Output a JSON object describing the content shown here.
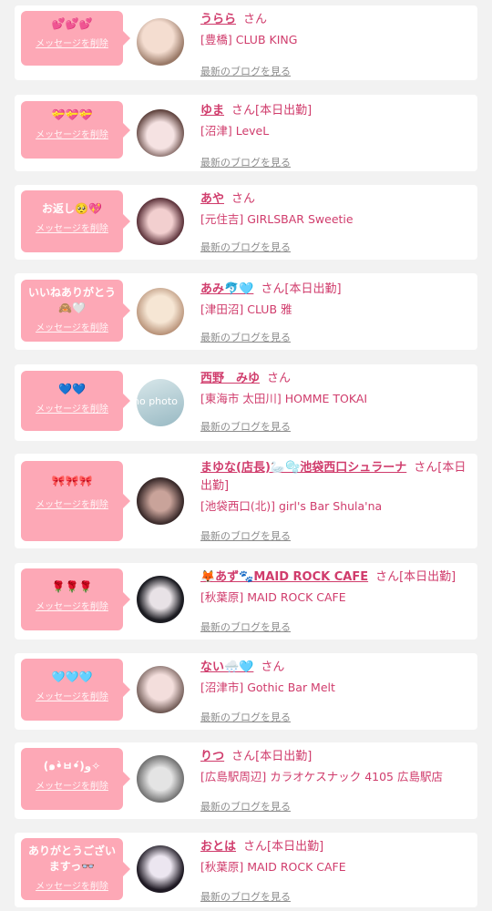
{
  "delete_label": "メッセージを削除",
  "blog_label": "最新のブログを見る",
  "san": "さん",
  "items": [
    {
      "message": "💕💕💕",
      "name": "うらら",
      "suffix": "",
      "shop": "[豊橋] CLUB KING",
      "avatar_colors": [
        "#f1d6c8",
        "#8a6b5a"
      ]
    },
    {
      "message": "💝💝💝",
      "name": "ゆま",
      "suffix": "[本日出勤]",
      "shop": "[沼津] LeveL",
      "avatar_colors": [
        "#f4dde0",
        "#6b4a44"
      ]
    },
    {
      "message": "お返し🥺💖",
      "name": "あや",
      "suffix": "",
      "shop": "[元住吉] GIRLSBAR Sweetie",
      "avatar_colors": [
        "#f3c8c9",
        "#5b2f36"
      ]
    },
    {
      "message": "いいねありがとう🙈🤍",
      "name": "あみ🐬🩵",
      "suffix": "[本日出勤]",
      "shop": "[津田沼] CLUB 雅",
      "avatar_colors": [
        "#f5e3cf",
        "#b79279"
      ]
    },
    {
      "message": "💙💙",
      "name": "西野　みゆ",
      "suffix": "",
      "shop": "[東海市 太田川] HOMME TOKAI",
      "avatar_colors": [
        "#cfe1e6",
        "#8fb2bd"
      ],
      "avatar_text": "no photo"
    },
    {
      "message": "🎀🎀🎀",
      "name": "まゆな(店長)🦢🫧池袋西口シュラーナ",
      "suffix": "[本日出勤]",
      "shop": "[池袋西口(北)] girl's Bar Shula'na",
      "avatar_colors": [
        "#3a2a2a",
        "#c9a39a"
      ]
    },
    {
      "message": "🌹🌹🌹",
      "name": "🦊あず🐾MAID ROCK CAFE",
      "suffix": "[本日出勤]",
      "shop": "[秋葉原] MAID ROCK CAFE",
      "avatar_colors": [
        "#1c1c22",
        "#e8e2e6"
      ]
    },
    {
      "message": "🩵🩵🩵",
      "name": "ない🌨️🩵",
      "suffix": "",
      "shop": "[沼津市] Gothic Bar Melt",
      "avatar_colors": [
        "#f0d9d7",
        "#6d5752"
      ]
    },
    {
      "message": "(๑•̀ㅂ•́)و✧",
      "name": "りつ",
      "suffix": "[本日出勤]",
      "shop": "[広島駅周辺] カラオケスナック 4105 広島駅店",
      "avatar_colors": [
        "#dcdcdc",
        "#6a6a6a"
      ]
    },
    {
      "message": "ありがとうございますっ👓",
      "name": "おとは",
      "suffix": "[本日出勤]",
      "shop": "[秋葉原] MAID ROCK CAFE",
      "avatar_colors": [
        "#e9e4ee",
        "#1f1a24"
      ]
    }
  ]
}
